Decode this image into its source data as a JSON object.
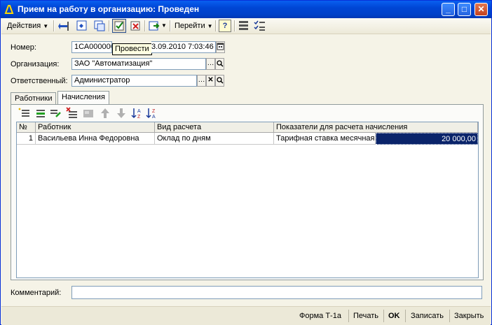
{
  "window": {
    "title": "Прием на работу в организацию: Проведен",
    "minimize": "_",
    "maximize": "□",
    "close": "✕"
  },
  "toolbar": {
    "actions_label": "Действия",
    "goto_label": "Перейти",
    "help_label": "?",
    "tooltip": "Провести"
  },
  "form": {
    "number_label": "Номер:",
    "number_value": "1СА000000",
    "date_value": "3.09.2010  7:03:46",
    "org_label": "Организация:",
    "org_value": "ЗАО \"Автоматизация\"",
    "resp_label": "Ответственный:",
    "resp_value": "Администратор",
    "comment_label": "Комментарий:",
    "comment_value": ""
  },
  "tabs": [
    {
      "label": "Работники"
    },
    {
      "label": "Начисления"
    }
  ],
  "grid": {
    "columns": [
      "№",
      "Работник",
      "Вид расчета",
      "Показатели для расчета начисления"
    ],
    "rows": [
      {
        "num": "1",
        "employee": "Васильева Инна Федоровна",
        "calc_type": "Оклад по дням",
        "indicator": "Тарифная ставка месячная",
        "amount": "20 000,00"
      }
    ]
  },
  "statusbar": {
    "form_t1a": "Форма Т-1а",
    "print": "Печать",
    "ok": "OK",
    "save": "Записать",
    "close": "Закрыть"
  },
  "colors": {
    "titlebar": "#0046D5",
    "selected_cell": "#0A246A",
    "tooltip_bg": "#FFFFE1"
  }
}
